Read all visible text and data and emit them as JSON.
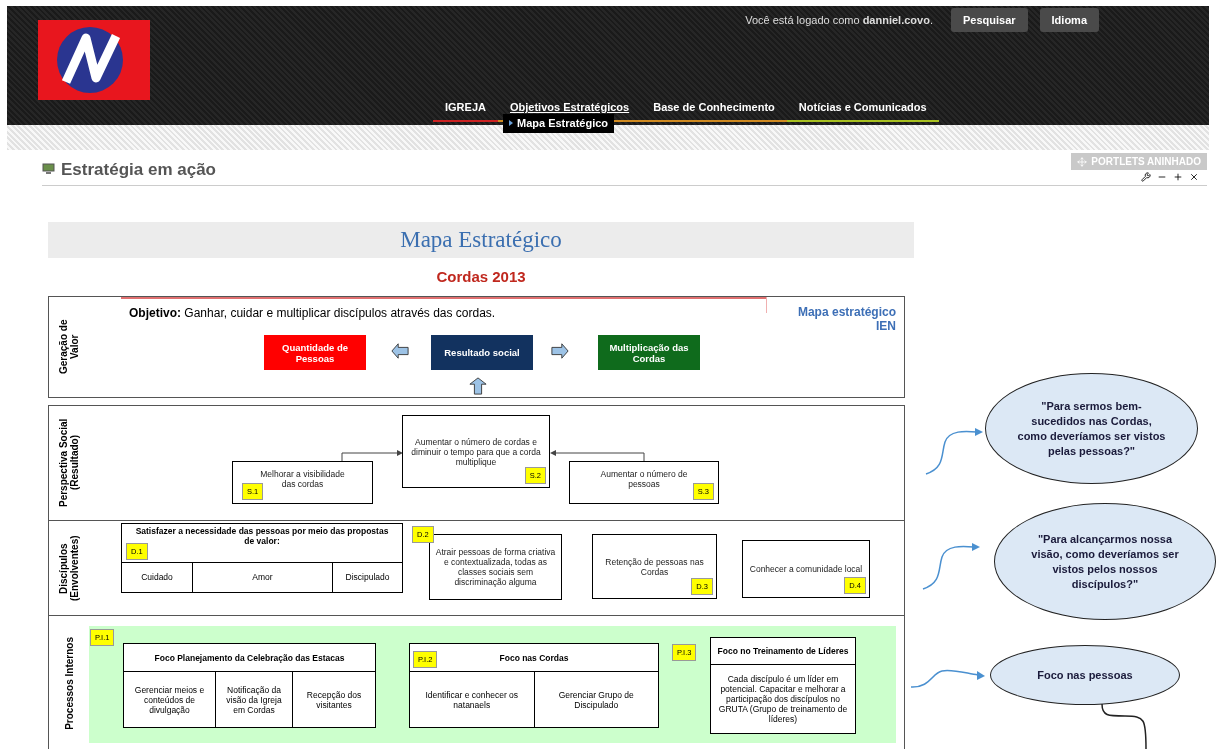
{
  "header": {
    "login": "Você está logado como **danniel.covo**.",
    "buttons": [
      "Pesquisar",
      "Idioma"
    ],
    "nav": [
      {
        "label": "IGREJA",
        "selected": false,
        "color": "#cc2222"
      },
      {
        "label": "Objetivos Estratégicos",
        "selected": true,
        "color": "#d08a20"
      },
      {
        "label": "Base de Conhecimento",
        "selected": false,
        "color": "#d08a20"
      },
      {
        "label": "Notícias e Comunicados",
        "selected": false,
        "color": "#a8c020"
      }
    ],
    "submenu": "Mapa Estratégico"
  },
  "portlet": {
    "title": "Estratégia em ação",
    "nested_button": "PORTLETS ANINHADO"
  },
  "map": {
    "title": "Mapa Estratégico",
    "subtitle": "Cordas 2013",
    "value_row": {
      "label": "Geração de Valor",
      "objective": "**Objetivo:** Ganhar, cuidar e multiplicar discípulos através das cordas.",
      "note": "Mapa estratégico IEN",
      "boxes": [
        {
          "text": "Quantidade de Pessoas",
          "color": "#ff0000"
        },
        {
          "text": "Resultado social",
          "color": "#12325f"
        },
        {
          "text": "Multiplicação das Cordas",
          "color": "#0f6b1c"
        }
      ]
    },
    "social_row": {
      "label": "Perspectiva Social (Resultado)",
      "nodes": [
        {
          "text": "Melhorar a visibilidade das cordas",
          "code": "S.1"
        },
        {
          "text": "Aumentar o número de cordas e diminuir o tempo para que a corda multiplique",
          "code": "S.2"
        },
        {
          "text": "Aumentar o número de pessoas",
          "code": "S.3"
        }
      ]
    },
    "disciples_row": {
      "label": "Discípulos (Envolventes)",
      "group": {
        "title": "Satisfazer a necessidade das pessoas por meio das propostas de valor:",
        "code": "D.1",
        "cells": [
          "Cuidado",
          "Amor",
          "Discipulado"
        ]
      },
      "nodes": [
        {
          "text": "Atrair pessoas de forma criativa e contextualizada, todas as classes sociais sem discriminação alguma",
          "code": "D.2"
        },
        {
          "text": "Retenção de pessoas nas Cordas",
          "code": "D.3"
        },
        {
          "text": "Conhecer a comunidade local",
          "code": "D.4"
        }
      ]
    },
    "process_row": {
      "label": "Processos Internos",
      "groups": [
        {
          "code": "P.I.1",
          "title": "Foco Planejamento da Celebração das Estacas",
          "cells": [
            "Gerenciar meios e conteúdos de divulgação",
            "Notificação da visão da Igreja em Cordas",
            "Recepção dos visitantes"
          ]
        },
        {
          "code": "P.I.2",
          "title": "Foco nas Cordas",
          "cells": [
            "Identificar e conhecer os natanaels",
            "Gerenciar Grupo de Discipulado"
          ]
        },
        {
          "code": "P.I.3",
          "title": "Foco no Treinamento de Líderes",
          "cells": [
            "Cada discípulo é um líder em potencial. Capacitar e melhorar a participação dos discípulos no GRUTA (Grupo de treinamento de líderes)"
          ]
        }
      ]
    }
  },
  "bubbles": [
    "\"Para sermos bem-sucedidos nas Cordas, como deveríamos ser vistos pelas pessoas?\"",
    "\"Para alcançarmos nossa visão, como deveríamos ser vistos pelos nossos discípulos?\"",
    "Foco nas pessoas"
  ]
}
